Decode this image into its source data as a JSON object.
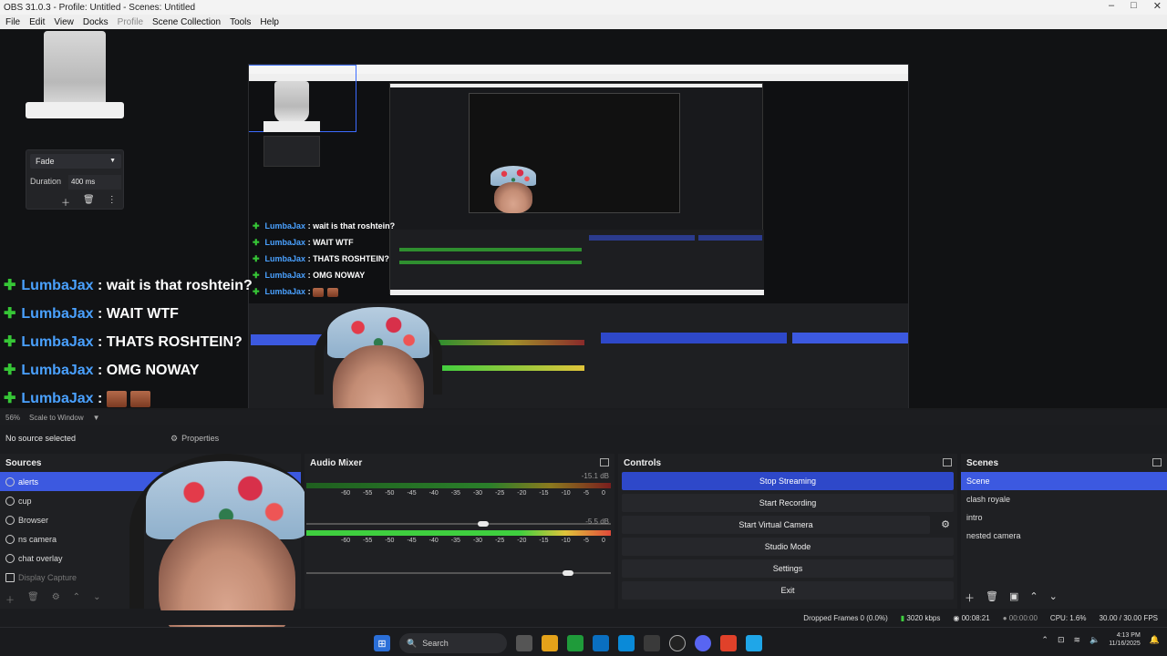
{
  "window": {
    "title": "OBS 31.0.3 - Profile: Untitled - Scenes: Untitled",
    "controls": [
      "–",
      "□",
      "✕"
    ]
  },
  "menu": [
    "File",
    "Edit",
    "View",
    "Docks",
    "Profile",
    "Scene Collection",
    "Tools",
    "Help"
  ],
  "transition": {
    "type": "Fade",
    "duration_label": "Duration",
    "duration_value": "400 ms"
  },
  "chat": [
    {
      "user": "LumbaJax",
      "text": ": wait is that roshtein?"
    },
    {
      "user": "LumbaJax",
      "text": ": WAIT WTF"
    },
    {
      "user": "LumbaJax",
      "text": ": THATS ROSHTEIN?"
    },
    {
      "user": "LumbaJax",
      "text": ": OMG NOWAY"
    },
    {
      "user": "LumbaJax",
      "text": ":"
    }
  ],
  "preview": {
    "zoom": "56%",
    "scale_mode": "Scale to Window"
  },
  "source_bar": {
    "no_source": "No source selected",
    "properties": "Properties"
  },
  "sources": {
    "title": "Sources",
    "items": [
      {
        "label": "alerts",
        "selected": true
      },
      {
        "label": "cup",
        "selected": false
      },
      {
        "label": "Browser",
        "selected": false
      },
      {
        "label": "ns camera",
        "selected": false
      },
      {
        "label": "chat overlay",
        "selected": false
      },
      {
        "label": "Display Capture",
        "selected": false
      }
    ]
  },
  "mixer": {
    "title": "Audio Mixer",
    "channels": [
      {
        "db": "-15.1 dB",
        "level": 0.58,
        "volume": 0.58
      },
      {
        "db": "-5.5 dB",
        "level": 0.78,
        "volume": 0.86
      }
    ],
    "scale": [
      "-60",
      "-55",
      "-50",
      "-45",
      "-40",
      "-35",
      "-30",
      "-25",
      "-20",
      "-15",
      "-10",
      "-5",
      "0"
    ]
  },
  "controls": {
    "title": "Controls",
    "buttons": [
      {
        "label": "Stop Streaming",
        "active": true
      },
      {
        "label": "Start Recording",
        "active": false
      },
      {
        "label": "Start Virtual Camera",
        "active": false,
        "gear": true
      },
      {
        "label": "Studio Mode",
        "active": false
      },
      {
        "label": "Settings",
        "active": false
      },
      {
        "label": "Exit",
        "active": false
      }
    ]
  },
  "scenes": {
    "title": "Scenes",
    "items": [
      {
        "label": "Scene",
        "selected": true
      },
      {
        "label": "clash royale",
        "selected": false
      },
      {
        "label": "intro",
        "selected": false
      },
      {
        "label": "nested camera",
        "selected": false
      }
    ]
  },
  "status": {
    "dropped": "Dropped Frames 0 (0.0%)",
    "bitrate": "3020 kbps",
    "stream_time": "00:08:21",
    "rec_time": "00:00:00",
    "cpu": "CPU: 1.6%",
    "fps": "30.00 / 30.00 FPS"
  },
  "taskbar": {
    "search": "Search",
    "time": "4:13 PM",
    "date": "11/16/2025"
  },
  "colors": {
    "accent": "#3c59e0",
    "active_button": "#2e48c9",
    "chat_user": "#4aa1ff",
    "chat_star": "#36c636"
  }
}
